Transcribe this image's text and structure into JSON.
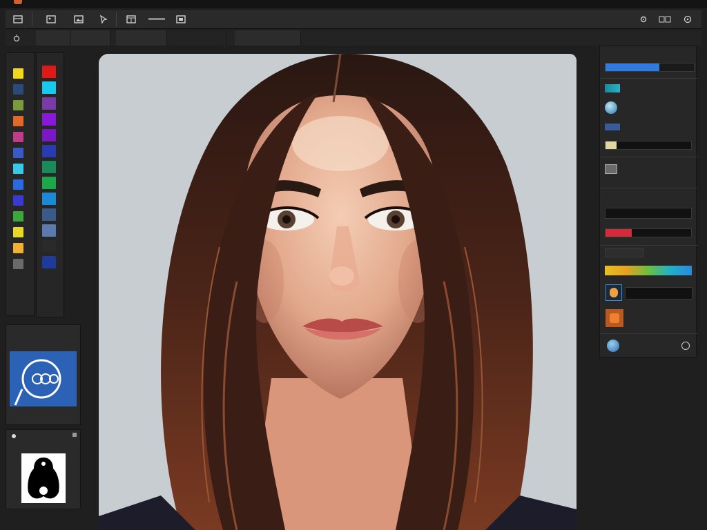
{
  "menu": {
    "items": [
      "",
      "",
      "",
      ""
    ]
  },
  "toolbar": {
    "buttons": [
      "grid-icon",
      "image-icon",
      "cursor-icon",
      "panel-icon",
      "minus-icon",
      "layers-icon"
    ],
    "right_icons": [
      "settings-icon",
      "view-icon",
      "help-icon"
    ]
  },
  "options": {
    "items": [
      "",
      "",
      "",
      "",
      ""
    ]
  },
  "swatches": {
    "left_column": [
      "#f2d81c",
      "#2b4a7a",
      "#7a9b3a",
      "#e26a28",
      "#c23a8a",
      "#3a5ac8",
      "#39c8e8",
      "#2a6ae0",
      "#3a3ad0",
      "#3aa83a",
      "#e8d82a",
      "#f0b030",
      "#6a6a6a"
    ],
    "right_column": [
      "#e01818",
      "#18c8ee",
      "#7a3aa8",
      "#8a18d8",
      "#7a18c8",
      "#2a3ab0",
      "#1a8a5a",
      "#1aa84a",
      "#1a8ad8",
      "#3a5a8a",
      "#5a7ab0",
      "#2a2a2a",
      "#1e3a9a"
    ]
  },
  "navigator": {
    "title": "",
    "subtitle": "",
    "footer": ""
  },
  "layers": {
    "title": ""
  },
  "right_panel": {
    "title": "",
    "rows": [
      "",
      "",
      "",
      "",
      "",
      "",
      "",
      "",
      "",
      "",
      ""
    ]
  },
  "colors": {
    "accent_blue": "#2f7be0",
    "accent_red": "#d42a3a",
    "panel_bg": "#272727"
  }
}
